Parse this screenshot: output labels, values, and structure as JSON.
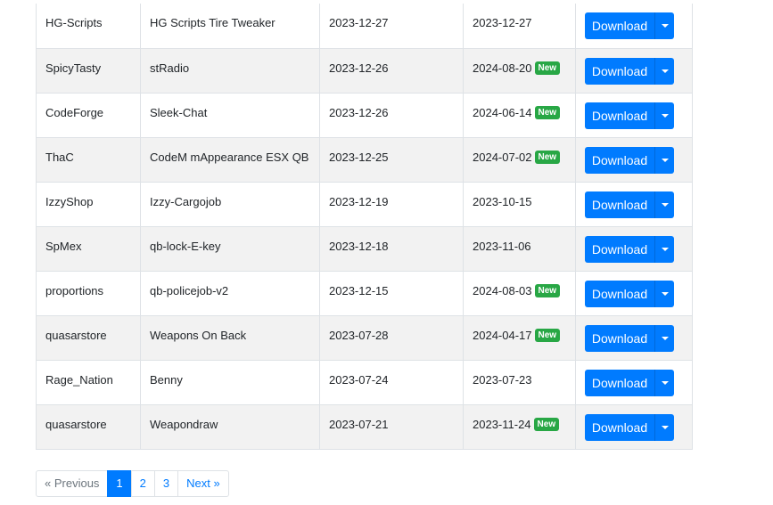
{
  "table": {
    "rows": [
      {
        "author": "HG-Scripts",
        "name": "HG Scripts Tire Tweaker",
        "created": "2023-12-27",
        "updated": "2023-12-27",
        "badge": ""
      },
      {
        "author": "SpicyTasty",
        "name": "stRadio",
        "created": "2023-12-26",
        "updated": "2024-08-20",
        "badge": "New"
      },
      {
        "author": "CodeForge",
        "name": "Sleek-Chat",
        "created": "2023-12-26",
        "updated": "2024-06-14",
        "badge": "New"
      },
      {
        "author": "ThaC",
        "name": "CodeM mAppearance ESX QB",
        "created": "2023-12-25",
        "updated": "2024-07-02",
        "badge": "New"
      },
      {
        "author": "IzzyShop",
        "name": "Izzy-Cargojob",
        "created": "2023-12-19",
        "updated": "2023-10-15",
        "badge": ""
      },
      {
        "author": "SpMex",
        "name": "qb-lock-E-key",
        "created": "2023-12-18",
        "updated": "2023-11-06",
        "badge": ""
      },
      {
        "author": "proportions",
        "name": "qb-policejob-v2",
        "created": "2023-12-15",
        "updated": "2024-08-03",
        "badge": "New"
      },
      {
        "author": "quasarstore",
        "name": "Weapons On Back",
        "created": "2023-07-28",
        "updated": "2024-04-17",
        "badge": "New"
      },
      {
        "author": "Rage_Nation",
        "name": "Benny",
        "created": "2023-07-24",
        "updated": "2023-07-23",
        "badge": ""
      },
      {
        "author": "quasarstore",
        "name": "Weapondraw",
        "created": "2023-07-21",
        "updated": "2023-11-24",
        "badge": "New"
      }
    ],
    "download_label": "Download",
    "dropdown_icon": "caret-down-icon"
  },
  "pagination": {
    "previous_label": "« Previous",
    "pages": [
      "1",
      "2",
      "3"
    ],
    "active_page": "1",
    "next_label": "Next »"
  },
  "colors": {
    "primary": "#007bff",
    "badge_new": "#28a745",
    "row_stripe": "#f2f2f2",
    "border": "#dee2e6"
  }
}
